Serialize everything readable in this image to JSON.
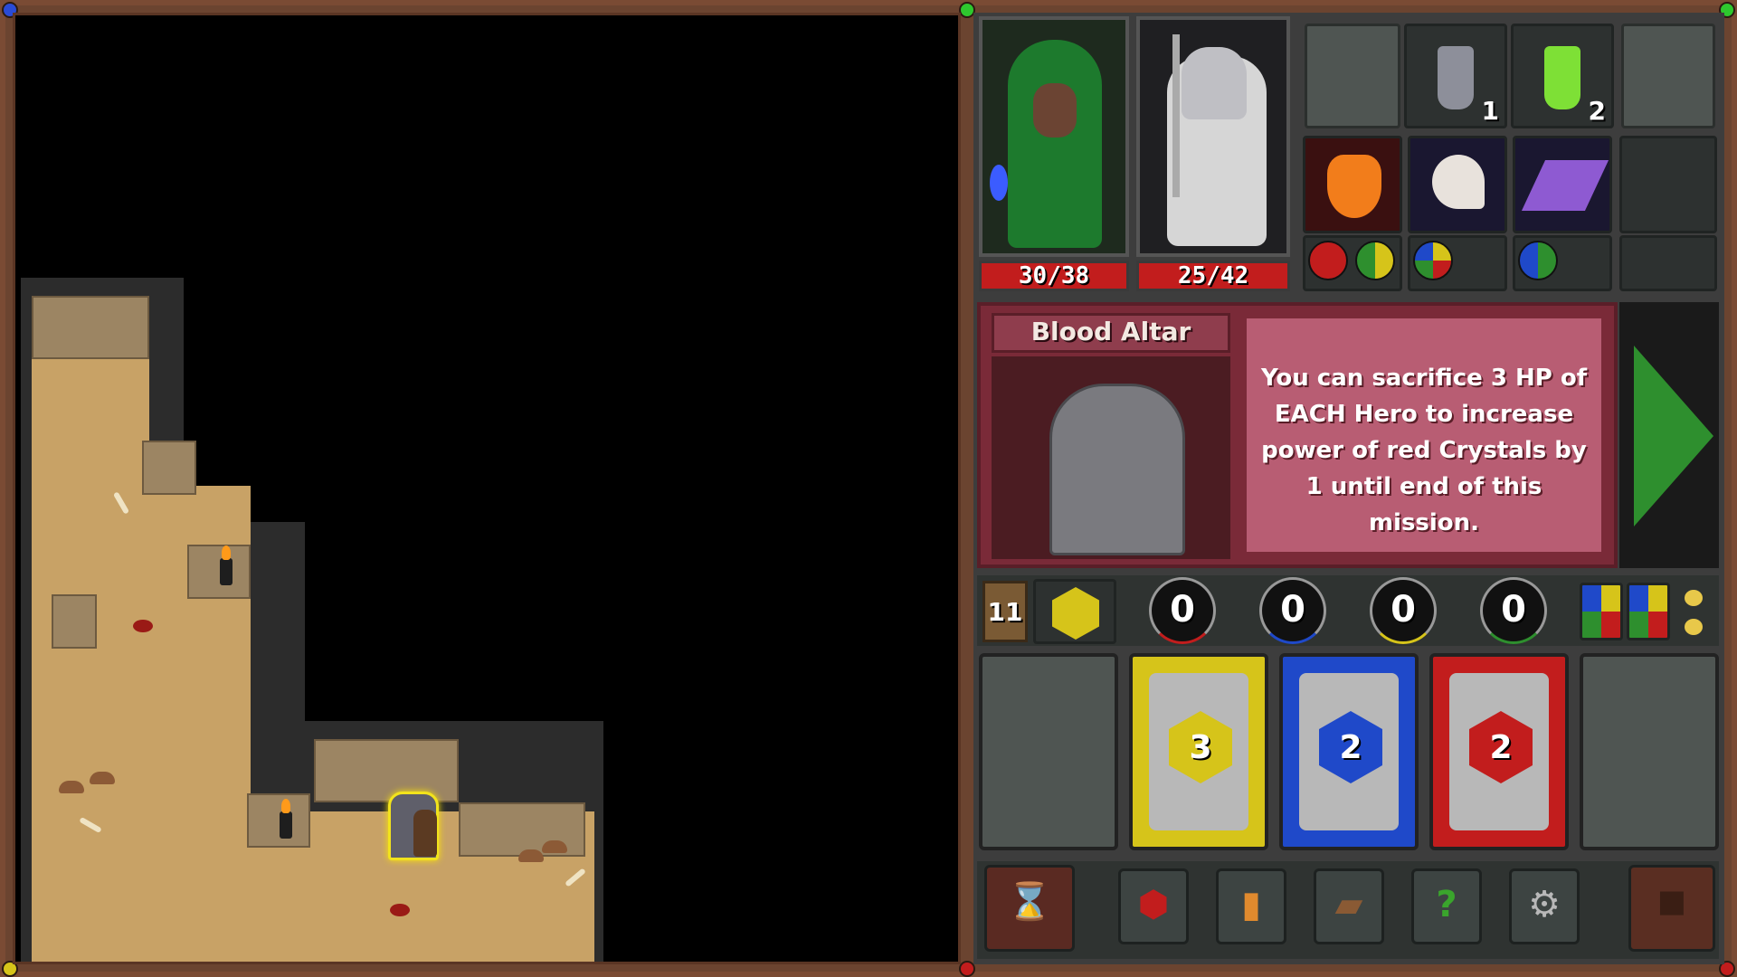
{
  "heroes": [
    {
      "name": "green-hooded-mage",
      "hp": "30/38"
    },
    {
      "name": "white-knight",
      "hp": "25/42"
    }
  ],
  "inventory": {
    "potion_grey_count": "1",
    "potion_green_count": "2"
  },
  "event": {
    "title": "Blood Altar",
    "description": "You can sacrifice 3 HP of EACH Hero to increase power of red Crystals by 1 until end of this mission."
  },
  "resources": {
    "turn_counter": "11",
    "red_pool": "0",
    "blue_pool": "0",
    "yellow_pool": "0",
    "green_pool": "0"
  },
  "cards": [
    {
      "color": "yellow",
      "value": "3"
    },
    {
      "color": "blue",
      "value": "2"
    },
    {
      "color": "red",
      "value": "2"
    }
  ],
  "colors": {
    "red": "#c21d1d",
    "blue": "#1f49c9",
    "yellow": "#d6c41a",
    "green": "#2e8f2e",
    "frame": "#7a4b34"
  },
  "toolbar": {
    "help_glyph": "?"
  }
}
